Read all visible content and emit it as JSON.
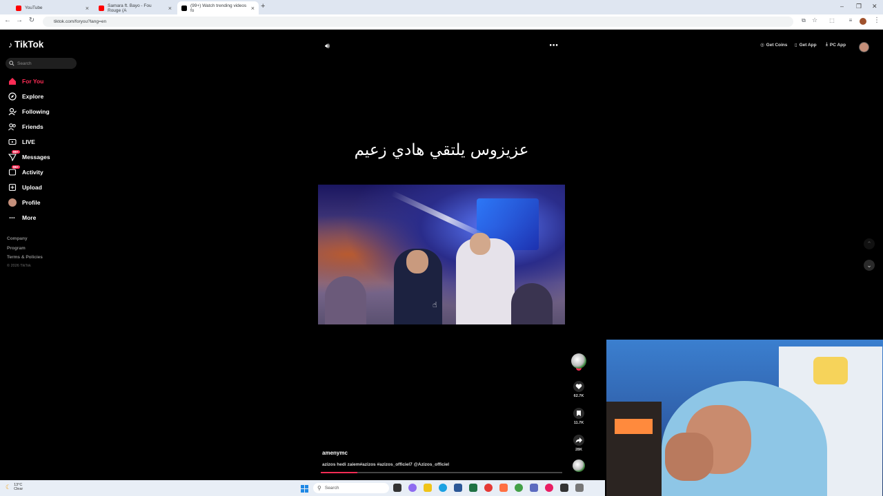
{
  "browser": {
    "tabs": [
      {
        "title": "YouTube",
        "color": "#ff0000",
        "active": false
      },
      {
        "title": "Samara ft. Bayo - Fou Rouge (A",
        "color": "#ff0000",
        "active": false
      },
      {
        "title": "(99+) Watch trending videos fo",
        "color": "#000000",
        "active": true
      }
    ],
    "new_tab": "+",
    "url": "tiktok.com/foryou?lang=en"
  },
  "sidebar": {
    "logo": "TikTok",
    "search_placeholder": "Search",
    "items": [
      {
        "label": "For You",
        "icon": "home-icon",
        "active": true
      },
      {
        "label": "Explore",
        "icon": "compass-icon"
      },
      {
        "label": "Following",
        "icon": "following-icon"
      },
      {
        "label": "Friends",
        "icon": "friends-icon"
      },
      {
        "label": "LIVE",
        "icon": "live-icon"
      },
      {
        "label": "Messages",
        "icon": "messages-icon",
        "badge": "99+"
      },
      {
        "label": "Activity",
        "icon": "activity-icon",
        "badge": "99+"
      },
      {
        "label": "Upload",
        "icon": "upload-icon"
      },
      {
        "label": "Profile",
        "icon": "avatar"
      },
      {
        "label": "More",
        "icon": "more-icon"
      }
    ],
    "footer_links": [
      "Company",
      "Program",
      "Terms & Policies"
    ],
    "copyright": "© 2026 TikTok"
  },
  "topbar": {
    "get_coins": "Get Coins",
    "get_app": "Get App",
    "pc_app": "PC App"
  },
  "video": {
    "overlay_caption": "عزيزوس يلتقي هادي زعيم",
    "username": "amenymc",
    "description": "azizos hedi zaiem#azizos #azizos_officiel7 @Azizos_officiel",
    "progress": 0.15,
    "likes": "62.7K",
    "saves": "11.7K",
    "shares": "28K"
  },
  "taskbar": {
    "temperature": "13°C",
    "weather": "Clear",
    "search_placeholder": "Search"
  },
  "colors": {
    "accent": "#fe2c55",
    "background": "#000000"
  }
}
